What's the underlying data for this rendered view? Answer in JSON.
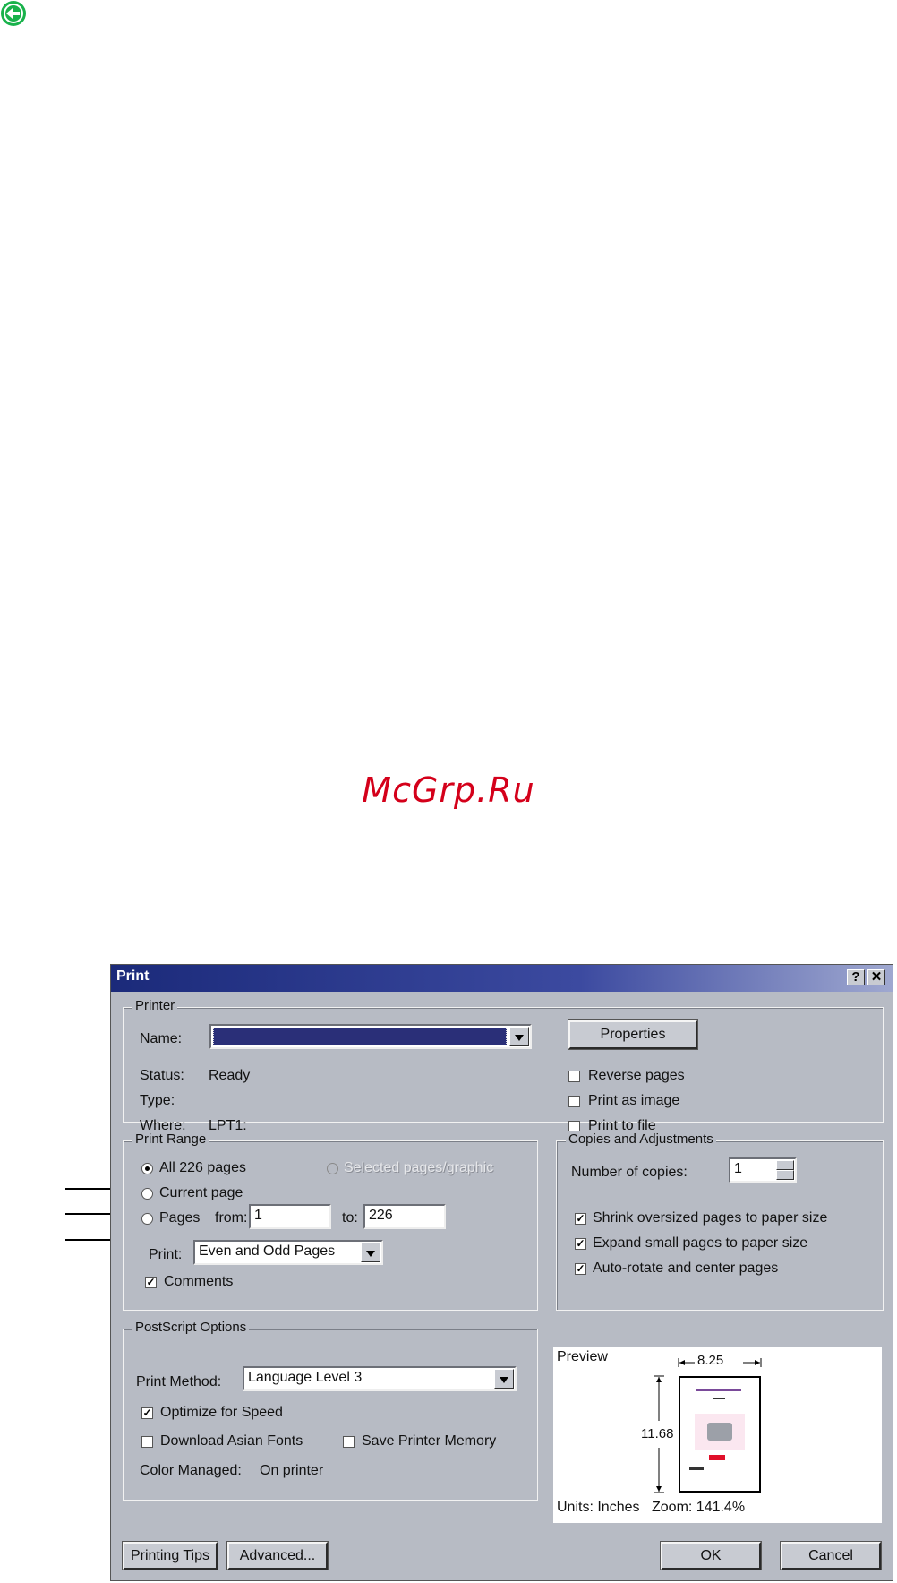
{
  "nav": {
    "back_icon": "back-arrow-icon",
    "back_color": "#19b24b"
  },
  "watermark": "McGrp.Ru",
  "dialog": {
    "title": "Print",
    "help_button": "?",
    "close_button": "✕",
    "printer": {
      "legend": "Printer",
      "name_label": "Name:",
      "name_value": "",
      "properties_button": "Properties",
      "status_label": "Status:",
      "status_value": "Ready",
      "type_label": "Type:",
      "type_value": "",
      "where_label": "Where:",
      "where_value": "LPT1:",
      "reverse_pages": "Reverse pages",
      "print_as_image": "Print as image",
      "print_to_file": "Print to file"
    },
    "print_range": {
      "legend": "Print Range",
      "all_pages": "All 226 pages",
      "selected": "Selected pages/graphic",
      "current_page": "Current page",
      "pages": "Pages",
      "from_label": "from:",
      "from_value": "1",
      "to_label": "to:",
      "to_value": "226",
      "print_label": "Print:",
      "print_value": "Even and Odd Pages",
      "comments": "Comments"
    },
    "copies": {
      "legend": "Copies and Adjustments",
      "number_label": "Number of copies:",
      "number_value": "1",
      "shrink": "Shrink oversized pages to paper size",
      "expand": "Expand small pages to paper size",
      "autorotate": "Auto-rotate and center pages"
    },
    "postscript": {
      "legend": "PostScript Options",
      "method_label": "Print Method:",
      "method_value": "Language Level 3",
      "optimize": "Optimize for Speed",
      "download_fonts": "Download Asian Fonts",
      "save_memory": "Save Printer Memory",
      "color_label": "Color Managed:",
      "color_value": "On printer"
    },
    "preview": {
      "label": "Preview",
      "width": "8.25",
      "height": "11.68",
      "units": "Units: Inches",
      "zoom": "Zoom: 141.4%"
    },
    "buttons": {
      "tips": "Printing Tips",
      "advanced": "Advanced...",
      "ok": "OK",
      "cancel": "Cancel"
    }
  }
}
